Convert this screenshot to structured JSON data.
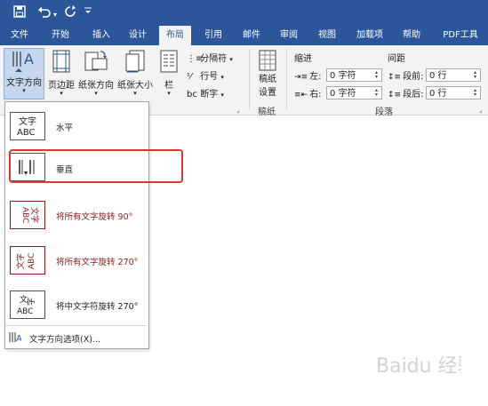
{
  "titlebar": {
    "save_icon": "save-icon",
    "undo_icon": "undo-icon",
    "more_icon": "customize-icon"
  },
  "tabs": [
    {
      "label": "文件"
    },
    {
      "label": "开始"
    },
    {
      "label": "插入"
    },
    {
      "label": "设计"
    },
    {
      "label": "布局",
      "active": true
    },
    {
      "label": "引用"
    },
    {
      "label": "邮件"
    },
    {
      "label": "审阅"
    },
    {
      "label": "视图"
    },
    {
      "label": "加载项"
    },
    {
      "label": "帮助"
    },
    {
      "label": "PDF工具"
    }
  ],
  "ribbon": {
    "text_direction": "文字方向",
    "margins": "页边距",
    "orientation": "纸张方向",
    "size": "纸张大小",
    "columns": "栏",
    "breaks": "分隔符",
    "line_numbers": "行号",
    "hyphenation": "断字",
    "manuscript_line1": "稿纸",
    "manuscript_line2": "设置",
    "manuscript_group": "稿纸",
    "indent_header": "缩进",
    "spacing_header": "间距",
    "indent_left_label": "左:",
    "indent_left_value": "0 字符",
    "indent_right_label": "右:",
    "indent_right_value": "0 字符",
    "spacing_before_label": "段前:",
    "spacing_before_value": "0 行",
    "spacing_after_label": "段后:",
    "spacing_after_value": "0 行",
    "paragraph_group": "段落"
  },
  "dropdown": {
    "items": [
      {
        "label": "水平"
      },
      {
        "label": "垂直"
      },
      {
        "label": "将所有文字旋转 90°"
      },
      {
        "label": "将所有文字旋转 270°"
      },
      {
        "label": "将中文字符旋转 270°"
      }
    ],
    "options_label": "文字方向选项(X)..."
  },
  "watermark": "Baidu 经验",
  "colors": {
    "accent": "#2b579a",
    "highlight": "#e0362a",
    "rotated_text": "#8b1a1a"
  }
}
